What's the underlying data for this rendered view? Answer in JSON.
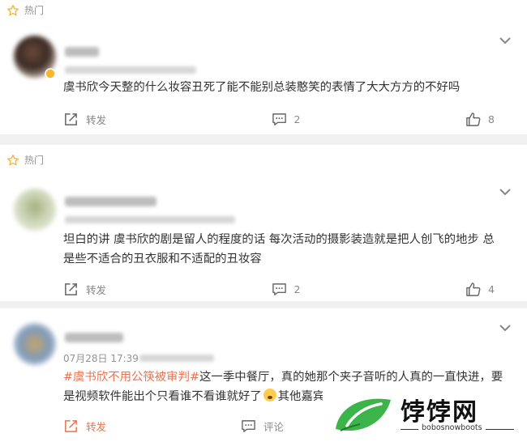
{
  "comments": [
    {
      "hot_label": "热门",
      "text": "虞书欣今天整的什么妆容丑死了能不能别总装憨笑的表情了大大方方的不好吗",
      "repost_label": "转发",
      "comment_count": "2",
      "like_count": "8"
    },
    {
      "hot_label": "热门",
      "text": "坦白的讲 虞书欣的剧是留人的程度的话 每次活动的摄影装造就是把人创飞的地步 总是些不适合的丑衣服和不适配的丑妆容",
      "repost_label": "转发",
      "comment_count": "2",
      "like_count": "4"
    },
    {
      "time": "07月28日 17:39",
      "hashtag": "#虞书欣不用公筷被审判#",
      "text_before_emoji": "这一季中餐厅，真的她那个夹子音听的人真的一直快进，要是视频软件能出个只看谁不看谁就好了",
      "text_after_emoji": "其他嘉宾",
      "repost_label": "转发",
      "comment_label": "评论"
    }
  ],
  "watermark": {
    "name": "饽饽网",
    "domain": "bobosnowboots"
  },
  "colors": {
    "accent": "#eb7350",
    "hot_icon": "#f2b43d",
    "logo_green": "#3bb44a"
  },
  "icons": [
    "star-icon",
    "chevron-down-icon",
    "repost-icon",
    "comment-icon",
    "like-icon",
    "vip-badge-icon",
    "emoji-icon",
    "leaf-logo-icon"
  ]
}
